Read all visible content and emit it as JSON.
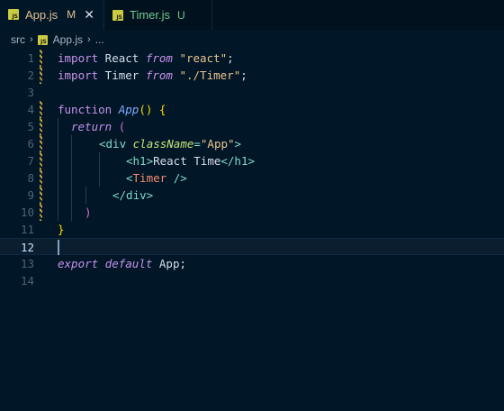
{
  "tabs": [
    {
      "label": "App.js",
      "status": "M",
      "icon": "js-file-icon",
      "icon_text": "JS",
      "active": true
    },
    {
      "label": "Timer.js",
      "status": "U",
      "icon": "js-file-icon",
      "icon_text": "JS",
      "active": false
    }
  ],
  "close_glyph": "✕",
  "breadcrumb": {
    "folder": "src",
    "file": "App.js",
    "more": "...",
    "separator": "›"
  },
  "editor": {
    "current_line": 12,
    "line_numbers": [
      "1",
      "2",
      "3",
      "4",
      "5",
      "6",
      "7",
      "8",
      "9",
      "10",
      "11",
      "12",
      "13",
      "14"
    ],
    "modified_lines": [
      1,
      2,
      4,
      5,
      6,
      7,
      8,
      9,
      10
    ]
  },
  "code": {
    "l1": {
      "import": "import",
      "name": " React ",
      "from": "from",
      "space": " ",
      "str": "\"react\"",
      "semi": ";"
    },
    "l2": {
      "import": "import",
      "name": " Timer ",
      "from": "from",
      "space": " ",
      "str": "\"./Timer\"",
      "semi": ";"
    },
    "l4": {
      "function": "function",
      "space": " ",
      "name": "App",
      "parens": "()",
      "space2": " ",
      "brace": "{"
    },
    "l5": {
      "return": "return",
      "space": " ",
      "paren": "("
    },
    "l6": {
      "open": "<div",
      "space": " ",
      "attr": "className",
      "eq": "=",
      "val": "\"App\"",
      "close": ">"
    },
    "l7": {
      "open": "<h1>",
      "text": "React Time",
      "close": "</h1>"
    },
    "l8": {
      "lt": "<",
      "comp": "Timer",
      "end": " />"
    },
    "l9": {
      "close": "</div>"
    },
    "l10": {
      "paren": ")"
    },
    "l11": {
      "brace": "}"
    },
    "l13": {
      "export": "export",
      "space": " ",
      "default": "default",
      "rest": " App;"
    }
  },
  "colors": {
    "background": "#011627",
    "keyword": "#c792ea",
    "string": "#ecc48d",
    "function": "#82aaff",
    "tag": "#7fdbca",
    "attribute": "#c5e478",
    "component": "#f78c6c",
    "modified_tab": "#e2c08d",
    "untracked_tab": "#73c991"
  }
}
